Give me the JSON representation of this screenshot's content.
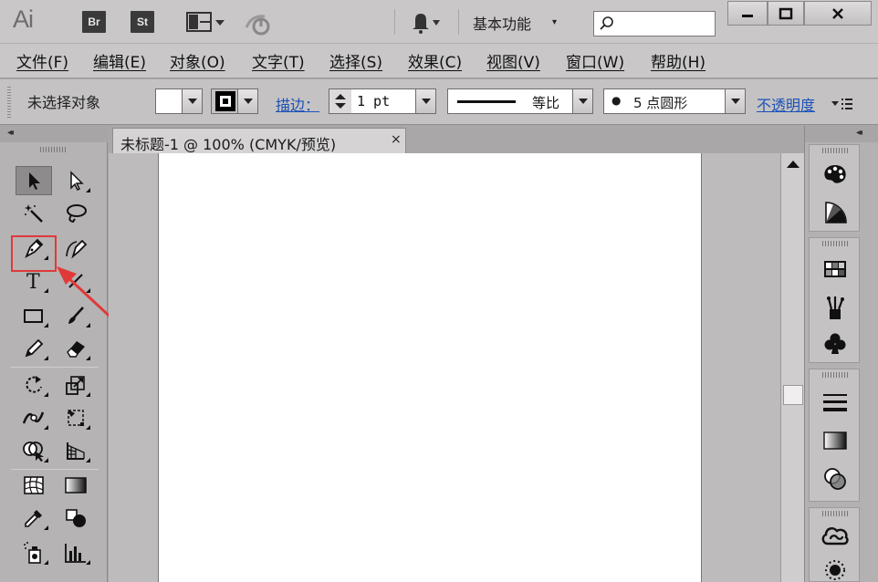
{
  "titlebar": {
    "app_logo": "Ai",
    "bridge_label": "Br",
    "stock_label": "St",
    "workspace": "基本功能",
    "workspace_caret": "▾",
    "search_placeholder": ""
  },
  "menu": {
    "items": [
      "文件(F)",
      "编辑(E)",
      "对象(O)",
      "文字(T)",
      "选择(S)",
      "效果(C)",
      "视图(V)",
      "窗口(W)",
      "帮助(H)"
    ]
  },
  "control": {
    "no_selection": "未选择对象",
    "stroke_label": "描边：",
    "stroke_weight": "1 pt",
    "profile_label": "等比",
    "brush_label": "5 点圆形",
    "brush_dot": "●",
    "opacity_label": "不透明度"
  },
  "document": {
    "tab_title": "未标题-1 @ 100% (CMYK/预览)",
    "tab_close": "×"
  },
  "icons": {
    "panel_collapse": "◂◂",
    "panel_expand": "▸▸"
  },
  "colors": {
    "highlight": "#e0393a",
    "link": "#1c52b8"
  }
}
